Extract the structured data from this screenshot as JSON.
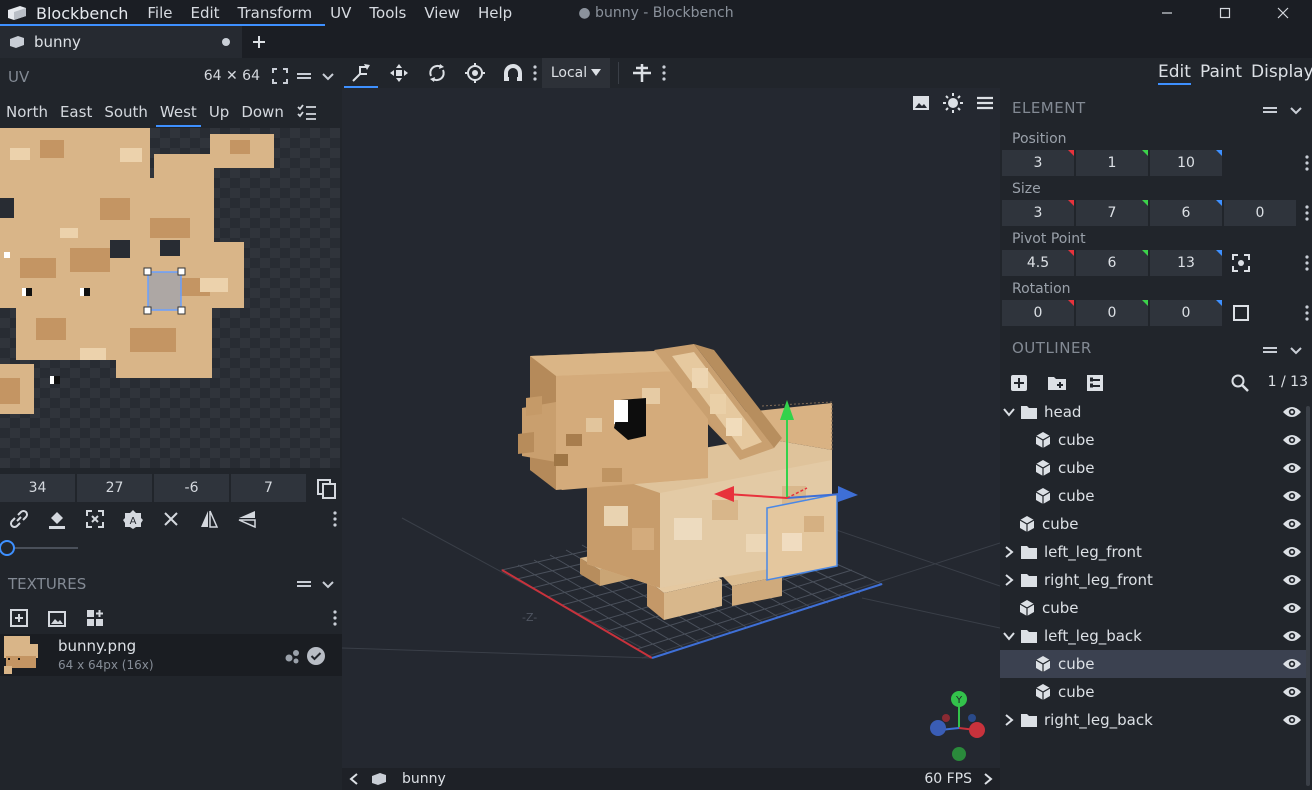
{
  "app": {
    "name": "Blockbench",
    "window_title": "● bunny - Blockbench",
    "menu": [
      "File",
      "Edit",
      "Transform",
      "UV",
      "Tools",
      "View",
      "Help"
    ]
  },
  "tabs": {
    "project_name": "bunny"
  },
  "uv": {
    "title": "UV",
    "size": "64 ✕ 64",
    "faces": [
      "North",
      "East",
      "South",
      "West",
      "Up",
      "Down"
    ],
    "active_face": "West",
    "inputs": [
      "34",
      "27",
      "-6",
      "7"
    ]
  },
  "textures": {
    "title": "TEXTURES",
    "item": {
      "name": "bunny.png",
      "meta": "64 x 64px (16x)"
    }
  },
  "viewport": {
    "transform_space": "Local",
    "model_name": "bunny",
    "fps": "60 FPS"
  },
  "modes": {
    "items": [
      "Edit",
      "Paint",
      "Display"
    ],
    "active": "Edit"
  },
  "element": {
    "title": "ELEMENT",
    "position": {
      "label": "Position",
      "values": [
        "3",
        "1",
        "10"
      ]
    },
    "size": {
      "label": "Size",
      "values": [
        "3",
        "7",
        "6",
        "0"
      ]
    },
    "pivot": {
      "label": "Pivot Point",
      "values": [
        "4.5",
        "6",
        "13"
      ]
    },
    "rotation": {
      "label": "Rotation",
      "values": [
        "0",
        "0",
        "0"
      ]
    },
    "axis_colors": [
      "#e8323c",
      "#3cd24b",
      "#3e90ff"
    ]
  },
  "outliner": {
    "title": "OUTLINER",
    "count": "1 / 13",
    "items": [
      {
        "label": "head",
        "type": "group",
        "depth": 0,
        "open": true
      },
      {
        "label": "cube",
        "type": "cube",
        "depth": 1
      },
      {
        "label": "cube",
        "type": "cube",
        "depth": 1
      },
      {
        "label": "cube",
        "type": "cube",
        "depth": 1
      },
      {
        "label": "cube",
        "type": "cube",
        "depth": 0
      },
      {
        "label": "left_leg_front",
        "type": "group",
        "depth": 0,
        "open": false
      },
      {
        "label": "right_leg_front",
        "type": "group",
        "depth": 0,
        "open": false
      },
      {
        "label": "cube",
        "type": "cube",
        "depth": 0
      },
      {
        "label": "left_leg_back",
        "type": "group",
        "depth": 0,
        "open": true
      },
      {
        "label": "cube",
        "type": "cube",
        "depth": 1,
        "selected": true
      },
      {
        "label": "cube",
        "type": "cube",
        "depth": 1
      },
      {
        "label": "right_leg_back",
        "type": "group",
        "depth": 0,
        "open": false
      }
    ]
  },
  "gizmo_labels": {
    "y": "Y"
  }
}
